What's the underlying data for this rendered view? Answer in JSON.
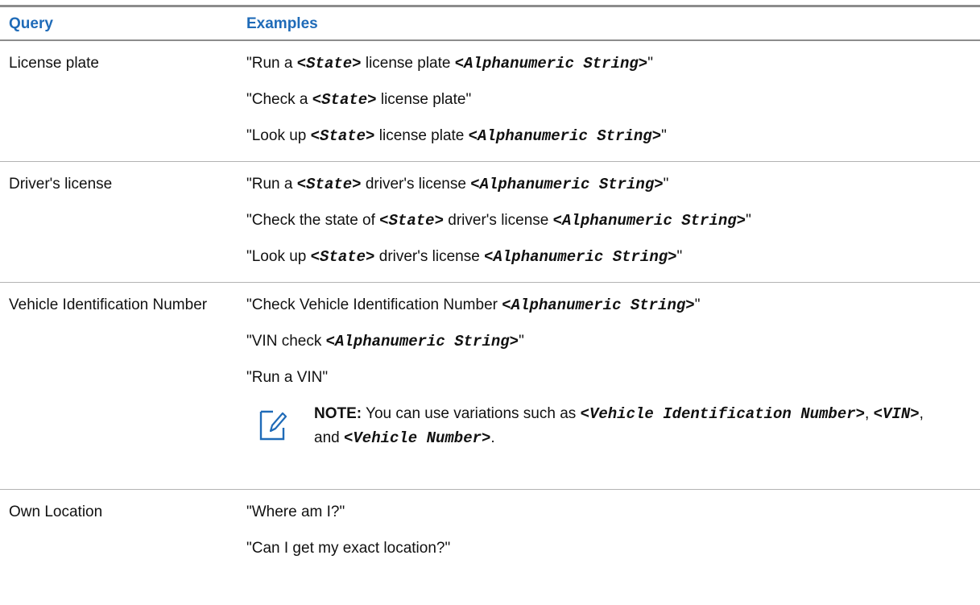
{
  "table": {
    "headers": {
      "query": "Query",
      "examples": "Examples"
    },
    "rows": [
      {
        "query": "License plate",
        "examples": [
          [
            "\"Run a ",
            "<State>",
            " license plate ",
            "<Alphanumeric String>",
            "\""
          ],
          [
            "\"Check a ",
            "<State>",
            " license plate\""
          ],
          [
            "\"Look up ",
            "<State>",
            " license plate ",
            "<Alphanumeric String>",
            "\""
          ]
        ]
      },
      {
        "query": "Driver's license",
        "examples": [
          [
            "\"Run a ",
            "<State>",
            " driver's license ",
            "<Alphanumeric String>",
            "\""
          ],
          [
            "\"Check the state of ",
            "<State>",
            " driver's license ",
            "<Alphanumeric String>",
            "\""
          ],
          [
            "\"Look up ",
            "<State>",
            " driver's license ",
            "<Alphanumeric String>",
            "\""
          ]
        ]
      },
      {
        "query": "Vehicle Identification Number",
        "examples": [
          [
            "\"Check Vehicle Identification Number ",
            "<Alphanumeric String>",
            "\""
          ],
          [
            "\"VIN check ",
            "<Alphanumeric String>",
            "\""
          ],
          [
            "\"Run a VIN\""
          ]
        ],
        "note": {
          "label": "NOTE:",
          "segments": [
            " You can use variations such as ",
            "<Vehicle Identification Number>",
            ", ",
            "<VIN>",
            ", and ",
            "<Vehicle Number>",
            "."
          ],
          "icon": "note-pencil-icon"
        }
      },
      {
        "query": "Own Location",
        "examples": [
          [
            "\"Where am I?\""
          ],
          [
            "\"Can I get my exact location?\""
          ]
        ]
      }
    ]
  },
  "colors": {
    "header_text": "#1f6bb8",
    "rule": "#8c8c8c",
    "row_divider": "#b3b3b3",
    "icon": "#1f6bb8"
  }
}
